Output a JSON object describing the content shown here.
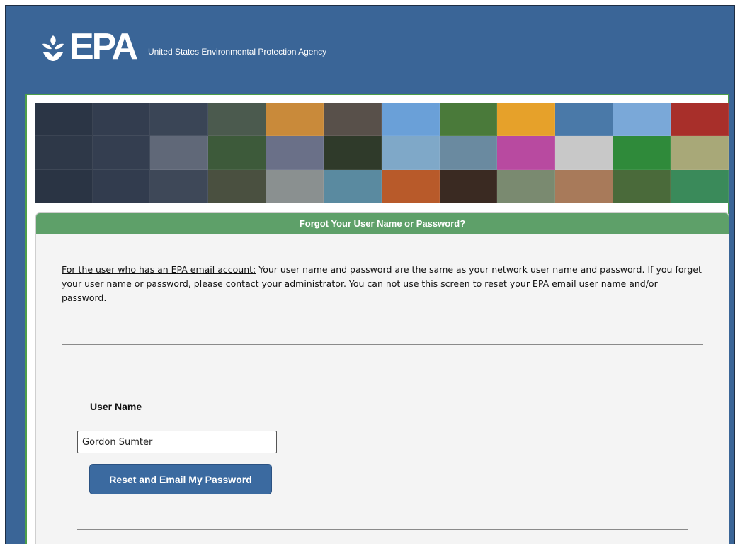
{
  "header": {
    "logo_text": "EPA",
    "agency_name": "United States Environmental Protection Agency"
  },
  "panel": {
    "title": "Forgot Your User Name or Password?",
    "info_label": "For the user who has an EPA email account:",
    "info_text": " Your user name and password are the same as your network user name and password. If you forget your user name or password, please contact your administrator. You can not use this screen to reset your EPA email user name and/or password."
  },
  "form": {
    "user_name_label": "User Name",
    "user_name_value": "Gordon Sumter",
    "reset_button_label": "Reset and Email My Password"
  },
  "colors": {
    "header_bg": "#3a6597",
    "content_border": "#4d9e4a",
    "panel_title_bg": "#5ea069",
    "button_bg": "#3b6aa0"
  },
  "banner_tiles": [
    "#2b3545",
    "#333d4f",
    "#3a4556",
    "#4b5a4e",
    "#c98a3a",
    "#58504a",
    "#6aa0d8",
    "#4a7a3a",
    "#e6a12a",
    "#4a79a8",
    "#7aa8d8",
    "#a82f2a",
    "#2e3848",
    "#343e50",
    "#606878",
    "#3d5a3a",
    "#6a7088",
    "#2f3a2a",
    "#7fa8c8",
    "#6a8aa0",
    "#b84aa0",
    "#c8c8c8",
    "#2f8a3a",
    "#a8a878",
    "#2a3444",
    "#323c4e",
    "#3e4858",
    "#4a5040",
    "#8a9090",
    "#5a8aa0",
    "#b85a2a",
    "#3a2a22",
    "#7a8a70",
    "#a87a5a",
    "#4a6a3a",
    "#3a8a5a"
  ]
}
